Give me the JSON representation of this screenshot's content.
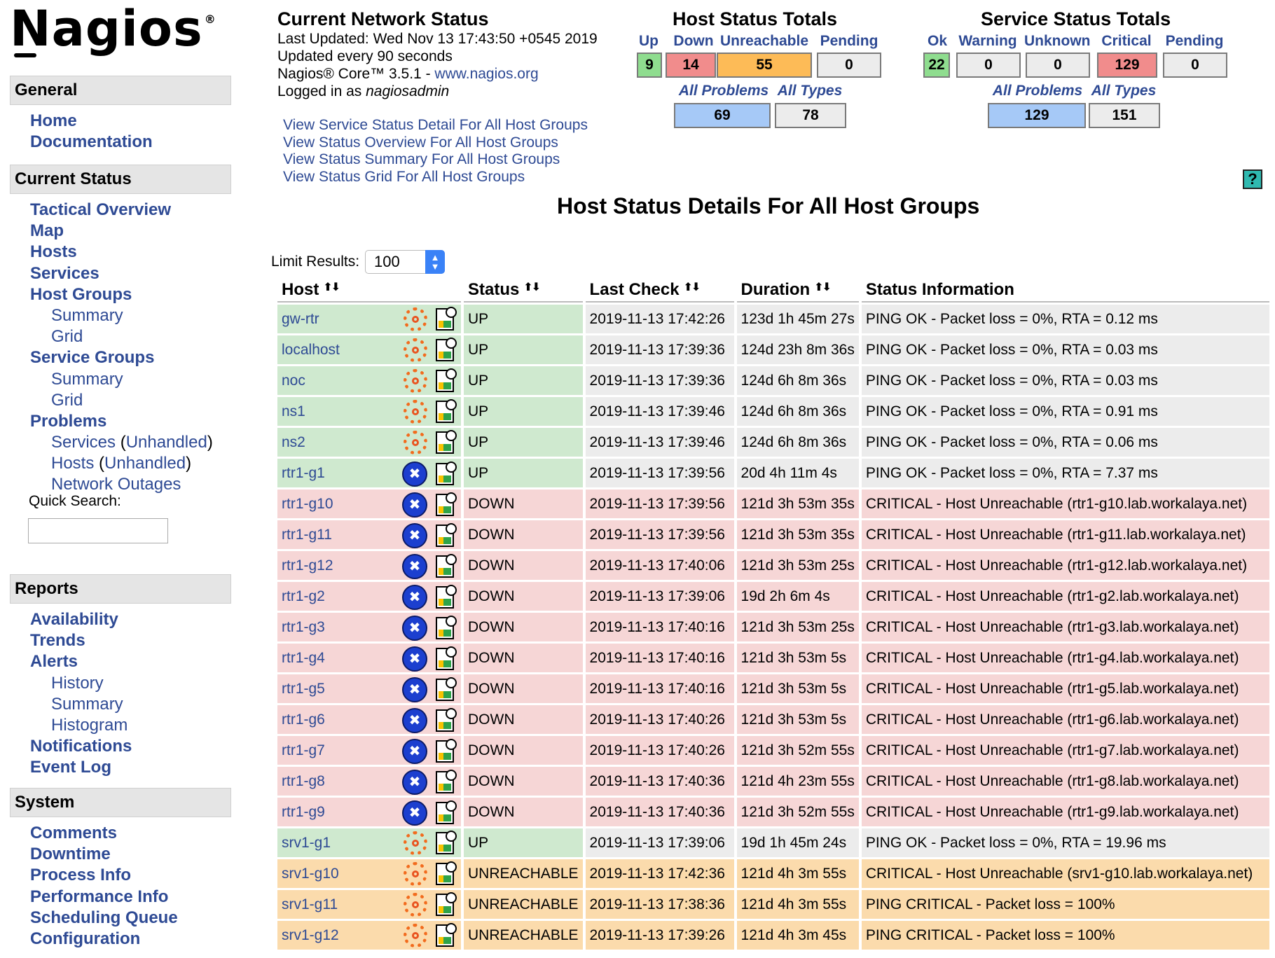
{
  "brand": {
    "logo": "Nagios",
    "reg": "®"
  },
  "sidebar": {
    "general": {
      "heading": "General",
      "items": [
        "Home",
        "Documentation"
      ]
    },
    "current_status": {
      "heading": "Current Status",
      "tactical": "Tactical Overview",
      "map": "Map",
      "hosts": "Hosts",
      "services": "Services",
      "host_groups": "Host Groups",
      "hg_summary": "Summary",
      "hg_grid": "Grid",
      "service_groups": "Service Groups",
      "sg_summary": "Summary",
      "sg_grid": "Grid",
      "problems": "Problems",
      "p_services": "Services",
      "p_services_unhandled": "Unhandled",
      "p_hosts": "Hosts",
      "p_hosts_unhandled": "Unhandled",
      "p_outages": "Network Outages",
      "quick_search": "Quick Search:"
    },
    "reports": {
      "heading": "Reports",
      "availability": "Availability",
      "trends": "Trends",
      "alerts": "Alerts",
      "history": "History",
      "summary": "Summary",
      "histogram": "Histogram",
      "notifications": "Notifications",
      "event_log": "Event Log"
    },
    "system": {
      "heading": "System",
      "comments": "Comments",
      "downtime": "Downtime",
      "process_info": "Process Info",
      "performance_info": "Performance Info",
      "scheduling_queue": "Scheduling Queue",
      "configuration": "Configuration"
    }
  },
  "network_status": {
    "title": "Current Network Status",
    "last_updated": "Last Updated: Wed Nov 13 17:43:50 +0545 2019",
    "updated_every": "Updated every 90 seconds",
    "core_prefix": "Nagios® Core™ 3.5.1 - ",
    "core_link": "www.nagios.org",
    "logged_prefix": "Logged in as ",
    "logged_user": "nagiosadmin"
  },
  "views": [
    "View Service Status Detail For All Host Groups",
    "View Status Overview For All Host Groups",
    "View Status Summary For All Host Groups",
    "View Status Grid For All Host Groups"
  ],
  "host_totals": {
    "title": "Host Status Totals",
    "labels": [
      "Up",
      "Down",
      "Unreachable",
      "Pending"
    ],
    "values": [
      "9",
      "14",
      "55",
      "0"
    ],
    "all_problems_label": "All Problems",
    "all_types_label": "All Types",
    "all_problems": "69",
    "all_types": "78"
  },
  "service_totals": {
    "title": "Service Status Totals",
    "labels": [
      "Ok",
      "Warning",
      "Unknown",
      "Critical",
      "Pending"
    ],
    "values": [
      "22",
      "0",
      "0",
      "129",
      "0"
    ],
    "all_problems_label": "All Problems",
    "all_types_label": "All Types",
    "all_problems": "129",
    "all_types": "151"
  },
  "colors": {
    "up": "#8fdd8f",
    "down": "#f18c8c",
    "unreachable": "#fdbb57",
    "neutral": "#ececec",
    "problems": "#a6c9f7",
    "link": "#2e4a94"
  },
  "help": "?",
  "main_title": "Host Status Details For All Host Groups",
  "limit": {
    "label": "Limit Results:",
    "value": "100"
  },
  "table": {
    "headers": [
      "Host",
      "Status",
      "Last Check",
      "Duration",
      "Status Information"
    ],
    "rows": [
      {
        "host": "gw-rtr",
        "icon": "ubuntu-icon",
        "status": "UP",
        "last_check": "2019-11-13 17:42:26",
        "duration": "123d 1h 45m 27s",
        "info": "PING OK - Packet loss = 0%, RTA = 0.12 ms"
      },
      {
        "host": "localhost",
        "icon": "ubuntu-icon",
        "status": "UP",
        "last_check": "2019-11-13 17:39:36",
        "duration": "124d 23h 8m 36s",
        "info": "PING OK - Packet loss = 0%, RTA = 0.03 ms"
      },
      {
        "host": "noc",
        "icon": "ubuntu-icon",
        "status": "UP",
        "last_check": "2019-11-13 17:39:36",
        "duration": "124d 6h 8m 36s",
        "info": "PING OK - Packet loss = 0%, RTA = 0.03 ms"
      },
      {
        "host": "ns1",
        "icon": "ubuntu-icon",
        "status": "UP",
        "last_check": "2019-11-13 17:39:46",
        "duration": "124d 6h 8m 36s",
        "info": "PING OK - Packet loss = 0%, RTA = 0.91 ms"
      },
      {
        "host": "ns2",
        "icon": "ubuntu-icon",
        "status": "UP",
        "last_check": "2019-11-13 17:39:46",
        "duration": "124d 6h 8m 36s",
        "info": "PING OK - Packet loss = 0%, RTA = 0.06 ms"
      },
      {
        "host": "rtr1-g1",
        "icon": "router-icon",
        "status": "UP",
        "last_check": "2019-11-13 17:39:56",
        "duration": "20d 4h 11m 4s",
        "info": "PING OK - Packet loss = 0%, RTA = 7.37 ms"
      },
      {
        "host": "rtr1-g10",
        "icon": "router-icon",
        "status": "DOWN",
        "last_check": "2019-11-13 17:39:56",
        "duration": "121d 3h 53m 35s",
        "info": "CRITICAL - Host Unreachable (rtr1-g10.lab.workalaya.net)"
      },
      {
        "host": "rtr1-g11",
        "icon": "router-icon",
        "status": "DOWN",
        "last_check": "2019-11-13 17:39:56",
        "duration": "121d 3h 53m 35s",
        "info": "CRITICAL - Host Unreachable (rtr1-g11.lab.workalaya.net)"
      },
      {
        "host": "rtr1-g12",
        "icon": "router-icon",
        "status": "DOWN",
        "last_check": "2019-11-13 17:40:06",
        "duration": "121d 3h 53m 25s",
        "info": "CRITICAL - Host Unreachable (rtr1-g12.lab.workalaya.net)"
      },
      {
        "host": "rtr1-g2",
        "icon": "router-icon",
        "status": "DOWN",
        "last_check": "2019-11-13 17:39:06",
        "duration": "19d 2h 6m 4s",
        "info": "CRITICAL - Host Unreachable (rtr1-g2.lab.workalaya.net)"
      },
      {
        "host": "rtr1-g3",
        "icon": "router-icon",
        "status": "DOWN",
        "last_check": "2019-11-13 17:40:16",
        "duration": "121d 3h 53m 25s",
        "info": "CRITICAL - Host Unreachable (rtr1-g3.lab.workalaya.net)"
      },
      {
        "host": "rtr1-g4",
        "icon": "router-icon",
        "status": "DOWN",
        "last_check": "2019-11-13 17:40:16",
        "duration": "121d 3h 53m 5s",
        "info": "CRITICAL - Host Unreachable (rtr1-g4.lab.workalaya.net)"
      },
      {
        "host": "rtr1-g5",
        "icon": "router-icon",
        "status": "DOWN",
        "last_check": "2019-11-13 17:40:16",
        "duration": "121d 3h 53m 5s",
        "info": "CRITICAL - Host Unreachable (rtr1-g5.lab.workalaya.net)"
      },
      {
        "host": "rtr1-g6",
        "icon": "router-icon",
        "status": "DOWN",
        "last_check": "2019-11-13 17:40:26",
        "duration": "121d 3h 53m 5s",
        "info": "CRITICAL - Host Unreachable (rtr1-g6.lab.workalaya.net)"
      },
      {
        "host": "rtr1-g7",
        "icon": "router-icon",
        "status": "DOWN",
        "last_check": "2019-11-13 17:40:26",
        "duration": "121d 3h 52m 55s",
        "info": "CRITICAL - Host Unreachable (rtr1-g7.lab.workalaya.net)"
      },
      {
        "host": "rtr1-g8",
        "icon": "router-icon",
        "status": "DOWN",
        "last_check": "2019-11-13 17:40:36",
        "duration": "121d 4h 23m 55s",
        "info": "CRITICAL - Host Unreachable (rtr1-g8.lab.workalaya.net)"
      },
      {
        "host": "rtr1-g9",
        "icon": "router-icon",
        "status": "DOWN",
        "last_check": "2019-11-13 17:40:36",
        "duration": "121d 3h 52m 55s",
        "info": "CRITICAL - Host Unreachable (rtr1-g9.lab.workalaya.net)"
      },
      {
        "host": "srv1-g1",
        "icon": "ubuntu-icon",
        "status": "UP",
        "last_check": "2019-11-13 17:39:06",
        "duration": "19d 1h 45m 24s",
        "info": "PING OK - Packet loss = 0%, RTA = 19.96 ms"
      },
      {
        "host": "srv1-g10",
        "icon": "ubuntu-icon",
        "status": "UNREACHABLE",
        "last_check": "2019-11-13 17:42:36",
        "duration": "121d 4h 3m 55s",
        "info": "CRITICAL - Host Unreachable (srv1-g10.lab.workalaya.net)"
      },
      {
        "host": "srv1-g11",
        "icon": "ubuntu-icon",
        "status": "UNREACHABLE",
        "last_check": "2019-11-13 17:38:36",
        "duration": "121d 4h 3m 55s",
        "info": "PING CRITICAL - Packet loss = 100%"
      },
      {
        "host": "srv1-g12",
        "icon": "ubuntu-icon",
        "status": "UNREACHABLE",
        "last_check": "2019-11-13 17:39:26",
        "duration": "121d 4h 3m 45s",
        "info": "PING CRITICAL - Packet loss = 100%"
      }
    ]
  }
}
